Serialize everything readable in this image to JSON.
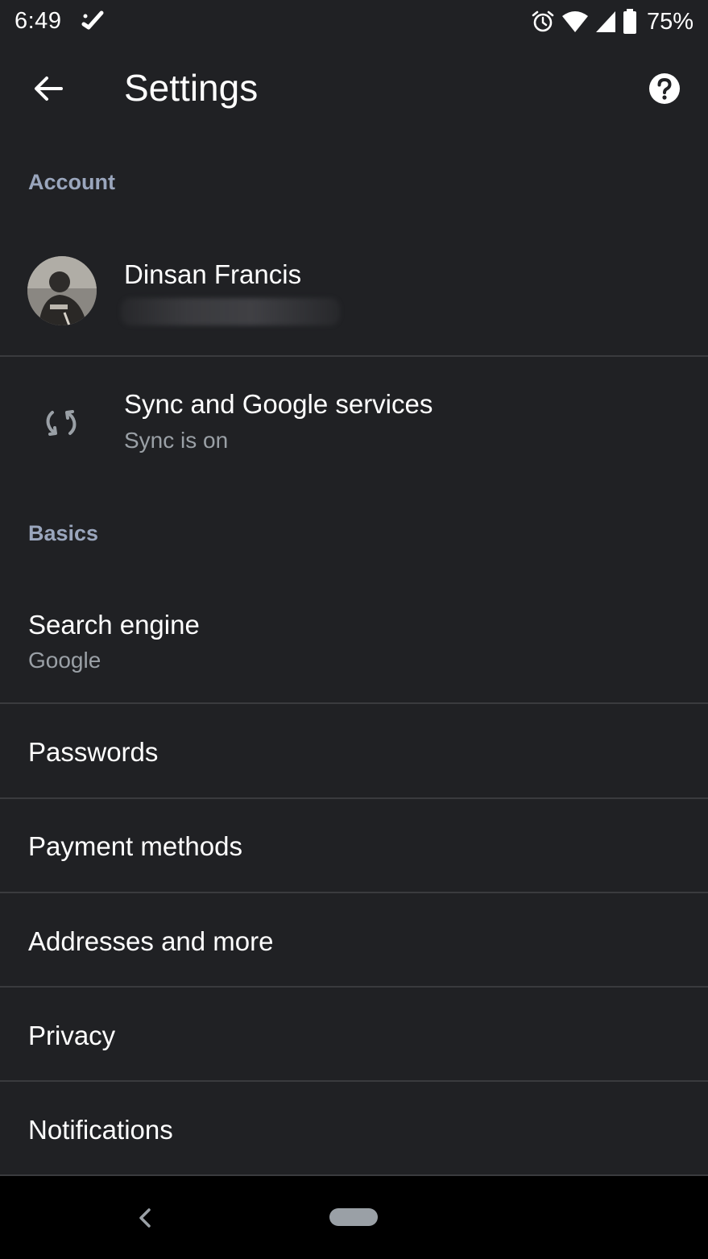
{
  "status_bar": {
    "time": "6:49",
    "battery_percent": "75%",
    "icons": [
      "tasks-check-icon",
      "alarm-icon",
      "wifi-icon",
      "cell-signal-icon",
      "battery-icon"
    ]
  },
  "app_bar": {
    "title": "Settings",
    "back_icon": "arrow-back-icon",
    "help_icon": "help-icon"
  },
  "account_section": {
    "header": "Account",
    "user_name": "Dinsan Francis",
    "sync": {
      "title": "Sync and Google services",
      "subtitle": "Sync is on",
      "icon": "sync-icon"
    }
  },
  "basics_section": {
    "header": "Basics",
    "items": [
      {
        "label": "Search engine",
        "subtitle": "Google"
      },
      {
        "label": "Passwords"
      },
      {
        "label": "Payment methods"
      },
      {
        "label": "Addresses and more"
      },
      {
        "label": "Privacy"
      },
      {
        "label": "Notifications"
      }
    ]
  },
  "nav_bar": {
    "back_icon": "nav-back-icon",
    "home_icon": "home-pill-icon"
  },
  "colors": {
    "background": "#202124",
    "section_header": "#9aa6bd",
    "divider": "#3a3b3e",
    "secondary_text": "#9aa0a6"
  }
}
